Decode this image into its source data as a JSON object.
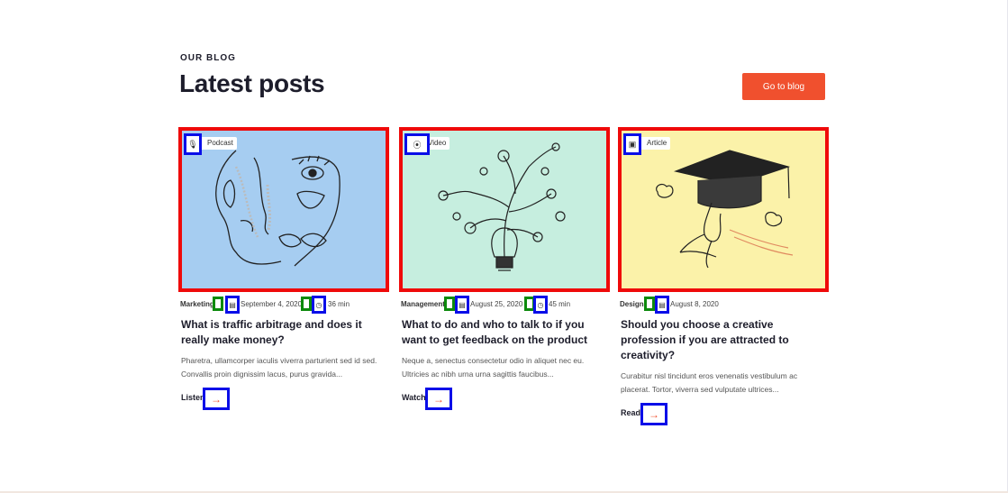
{
  "header": {
    "eyebrow": "OUR BLOG",
    "title": "Latest posts",
    "cta_label": "Go to blog"
  },
  "accent_color": "#f0502e",
  "posts": [
    {
      "badge": "Podcast",
      "badge_icon": "microphone-icon",
      "image_bg": "#a6cdf1",
      "category": "Marketing",
      "date": "September 4, 2020",
      "duration": "36 min",
      "title": "What is traffic arbitrage and does it really make money?",
      "excerpt": "Pharetra, ullamcorper iaculis viverra parturient sed id sed. Convallis proin dignissim lacus, purus gravida...",
      "action": "Listen"
    },
    {
      "badge": "Video",
      "badge_icon": "play-icon",
      "image_bg": "#c6eedf",
      "category": "Management",
      "date": "August 25, 2020",
      "duration": "45 min",
      "title": "What to do and who to talk to if you want to get feedback on the product",
      "excerpt": "Neque a, senectus consectetur odio in aliquet nec eu. Ultricies ac nibh urna urna sagittis faucibus...",
      "action": "Watch"
    },
    {
      "badge": "Article",
      "badge_icon": "document-icon",
      "image_bg": "#fbf2a9",
      "category": "Design",
      "date": "August 8, 2020",
      "title": "Should you choose a creative profession if you are attracted to creativity?",
      "excerpt": "Curabitur nisl tincidunt eros venenatis vestibulum ac placerat. Tortor, viverra sed vulputate ultrices...",
      "action": "Read"
    }
  ]
}
